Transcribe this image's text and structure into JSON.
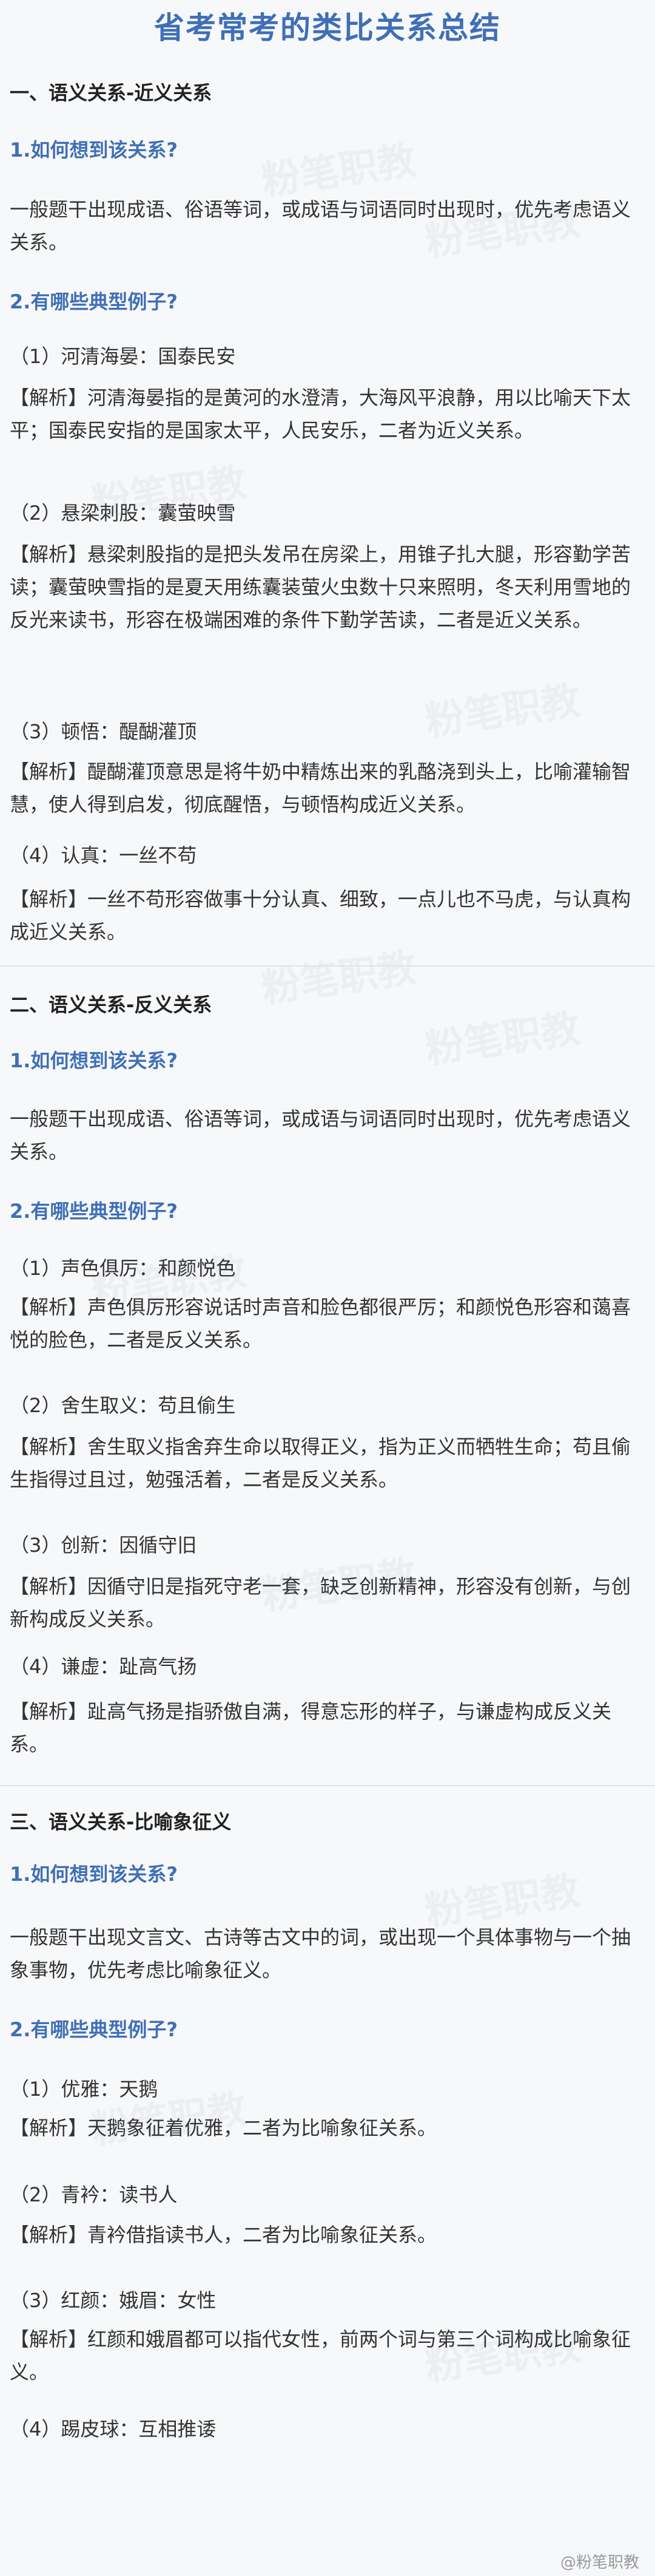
{
  "title": "省考常考的类比关系总结",
  "watermark": "粉笔职教",
  "weibo": "@粉笔职教",
  "sections": [
    {
      "heading": "一、语义关系-近义关系",
      "q1": "1.如何想到该关系?",
      "intro": "一般题干出现成语、俗语等词，或成语与词语同时出现时，优先考虑语义关系。",
      "q2": "2.有哪些典型例子?",
      "examples": [
        {
          "item": "（1）河清海晏：国泰民安",
          "tag": "【解析】",
          "text": "河清海晏指的是黄河的水澄清，大海风平浪静，用以比喻天下太平；国泰民安指的是国家太平，人民安乐，二者为近义关系。"
        },
        {
          "item": "（2）悬梁刺股：囊萤映雪",
          "tag": "【解析】",
          "text": "悬梁刺股指的是把头发吊在房梁上，用锥子扎大腿，形容勤学苦读；囊萤映雪指的是夏天用练囊装萤火虫数十只来照明，冬天利用雪地的反光来读书，形容在极端困难的条件下勤学苦读，二者是近义关系。"
        },
        {
          "item": "（3）顿悟：醍醐灌顶",
          "tag": "【解析】",
          "text": "醍醐灌顶意思是将牛奶中精炼出来的乳酪浇到头上，比喻灌输智慧，使人得到启发，彻底醒悟，与顿悟构成近义关系。"
        },
        {
          "item": "（4）认真：一丝不苟",
          "tag": "【解析】",
          "text": "一丝不苟形容做事十分认真、细致，一点儿也不马虎，与认真构成近义关系。"
        }
      ]
    },
    {
      "heading": "二、语义关系-反义关系",
      "q1": "1.如何想到该关系?",
      "intro": "一般题干出现成语、俗语等词，或成语与词语同时出现时，优先考虑语义关系。",
      "q2": "2.有哪些典型例子?",
      "examples": [
        {
          "item": "（1）声色俱厉：和颜悦色",
          "tag": "【解析】",
          "text": "声色俱厉形容说话时声音和脸色都很严厉；和颜悦色形容和蔼喜悦的脸色，二者是反义关系。"
        },
        {
          "item": "（2）舍生取义：苟且偷生",
          "tag": "【解析】",
          "text": "舍生取义指舍弃生命以取得正义，指为正义而牺牲生命；苟且偷生指得过且过，勉强活着，二者是反义关系。"
        },
        {
          "item": "（3）创新：因循守旧",
          "tag": "【解析】",
          "text": "因循守旧是指死守老一套，缺乏创新精神，形容没有创新，与创新构成反义关系。"
        },
        {
          "item": "（4）谦虚：趾高气扬",
          "tag": "【解析】",
          "text": "趾高气扬是指骄傲自满，得意忘形的样子，与谦虚构成反义关系。"
        }
      ]
    },
    {
      "heading": "三、语义关系-比喻象征义",
      "q1": "1.如何想到该关系?",
      "intro": "一般题干出现文言文、古诗等古文中的词，或出现一个具体事物与一个抽象事物，优先考虑比喻象征义。",
      "q2": "2.有哪些典型例子?",
      "examples": [
        {
          "item": "（1）优雅：天鹅",
          "tag": "【解析】",
          "text": "天鹅象征着优雅，二者为比喻象征关系。"
        },
        {
          "item": "（2）青衿：读书人",
          "tag": "【解析】",
          "text": "青衿借指读书人，二者为比喻象征关系。"
        },
        {
          "item": "（3）红颜：娥眉：女性",
          "tag": "【解析】",
          "text": "红颜和娥眉都可以指代女性，前两个词与第三个词构成比喻象征义。"
        },
        {
          "item": "（4）踢皮球：互相推诿",
          "tag": "",
          "text": ""
        }
      ]
    }
  ]
}
